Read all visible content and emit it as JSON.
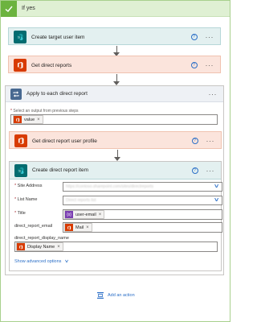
{
  "condition": {
    "title": "If yes"
  },
  "steps": {
    "create_target": {
      "title": "Create target user item",
      "help": "?",
      "more": "···"
    },
    "get_reports": {
      "title": "Get direct reports",
      "help": "?",
      "more": "···"
    },
    "apply_each": {
      "title": "Apply to each direct report",
      "more": "···",
      "select_label": "Select an output from previous steps",
      "token": "value",
      "inner": {
        "get_profile": {
          "title": "Get direct report user profile",
          "help": "?",
          "more": "···"
        },
        "create_item": {
          "title": "Create direct report item",
          "help": "?",
          "more": "···",
          "fields": {
            "site_address": {
              "label": "Site Address",
              "value": "https://contoso.sharepoint.com/sites/directreports"
            },
            "list_name": {
              "label": "List Name",
              "value": "Direct reports list"
            },
            "title": {
              "label": "Title",
              "token": "user-email"
            },
            "email": {
              "label": "direct_report_email",
              "token": "Mail"
            },
            "display": {
              "label": "direct_report_display_name",
              "token": "Display Name"
            }
          },
          "advanced": "Show advanced options"
        }
      }
    }
  },
  "add_action": "Add an action",
  "colors": {
    "sharepoint": "#036c70",
    "office365": "#d83b01",
    "loop": "#486991",
    "accent": "#2b6fc7",
    "yes": "#6cb33f"
  }
}
